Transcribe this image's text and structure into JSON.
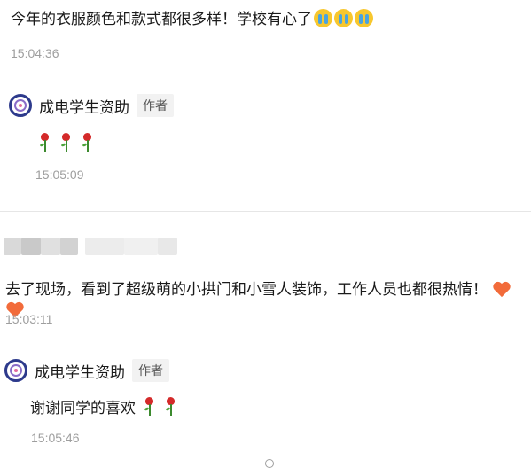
{
  "comment1": {
    "text": "今年的衣服颜色和款式都很多样！学校有心了",
    "emoji_count": 3,
    "emoji_icon": "loudly-crying-face-icon",
    "time": "15:04:36"
  },
  "reply1": {
    "author": "成电学生资助",
    "badge": "作者",
    "rose_count": 3,
    "rose_icon": "rose-icon",
    "time": "15:05:09"
  },
  "comment2": {
    "username_blurred": true,
    "text": "去了现场，看到了超级萌的小拱门和小雪人装饰，工作人员也都很热情！",
    "hearts": 2,
    "heart_icon": "orange-heart-icon",
    "time": "15:03:11"
  },
  "reply2": {
    "author": "成电学生资助",
    "badge": "作者",
    "text": "谢谢同学的喜欢",
    "rose_count": 2,
    "rose_icon": "rose-icon",
    "time": "15:05:46"
  },
  "colors": {
    "text": "#1a1a1a",
    "timestamp": "#9e9e9e",
    "badge_bg": "#f2f2f2",
    "heart": "#f26b3a",
    "rose": "#d42a2a"
  }
}
